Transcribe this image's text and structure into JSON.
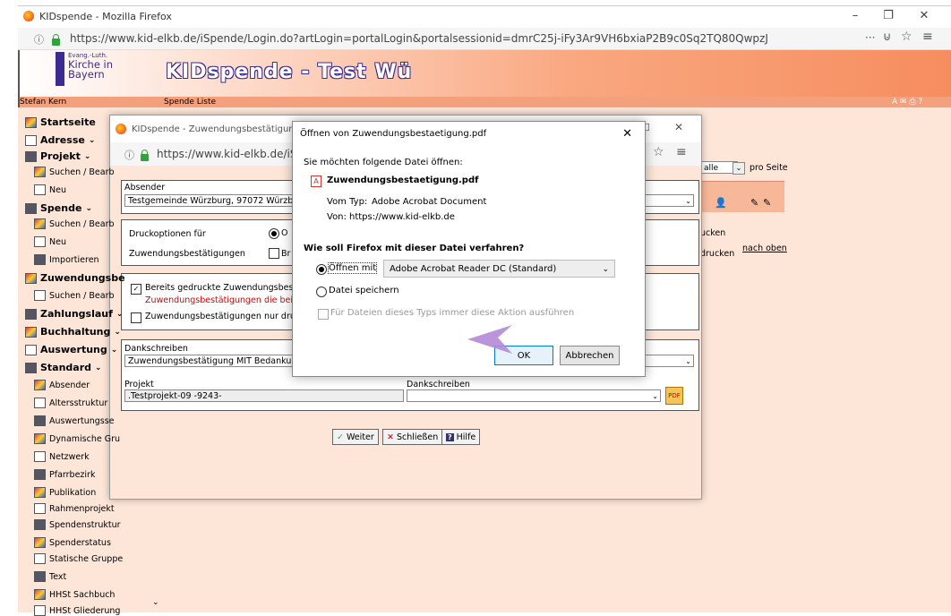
{
  "browser_outer": {
    "window_title": "KIDspende - Mozilla Firefox",
    "url": "https://www.kid-elkb.de/iSpende/Login.do?artLogin=portalLogin&portalsessionid=dmrC25j-iFy3Ar9VH6bxiaP2B9c0Sq2TQ80QwpzJ"
  },
  "app": {
    "logo_line1": "Evang.-Luth.",
    "logo_line2": "Kirche in",
    "logo_line3": "Bayern",
    "title": "KIDspende - Test Wü",
    "user": "Stefan Kern",
    "page_label": "Spende Liste"
  },
  "sidebar": {
    "items": [
      {
        "label": "Startseite",
        "bold": true
      },
      {
        "label": "Adresse",
        "bold": true
      },
      {
        "label": "Projekt",
        "bold": true
      },
      {
        "label": "Suchen / Bearb",
        "bold": false
      },
      {
        "label": "Neu",
        "bold": false
      },
      {
        "label": "Spende",
        "bold": true
      },
      {
        "label": "Suchen / Bearb",
        "bold": false
      },
      {
        "label": "Neu",
        "bold": false
      },
      {
        "label": "Importieren",
        "bold": false
      },
      {
        "label": "Zuwendungsbe",
        "bold": true
      },
      {
        "label": "Suchen / Bearb",
        "bold": false
      },
      {
        "label": "Zahlungslauf",
        "bold": true
      },
      {
        "label": "Buchhaltung",
        "bold": true
      },
      {
        "label": "Auswertung",
        "bold": true
      },
      {
        "label": "Standard",
        "bold": true
      },
      {
        "label": "Absender",
        "bold": false
      },
      {
        "label": "Altersstruktur",
        "bold": false
      },
      {
        "label": "Auswertungsse",
        "bold": false
      },
      {
        "label": "Dynamische Gru",
        "bold": false
      },
      {
        "label": "Netzwerk",
        "bold": false
      },
      {
        "label": "Pfarrbezirk",
        "bold": false
      },
      {
        "label": "Publikation",
        "bold": false
      },
      {
        "label": "Rahmenprojekt",
        "bold": false
      },
      {
        "label": "Spendenstruktur",
        "bold": false
      },
      {
        "label": "Spenderstatus",
        "bold": false
      },
      {
        "label": "Statische Gruppe",
        "bold": false
      },
      {
        "label": "Text",
        "bold": false
      },
      {
        "label": "HHSt Sachbuch",
        "bold": false
      },
      {
        "label": "HHSt Gliederung",
        "bold": false
      }
    ]
  },
  "right_area": {
    "page_select": "alle",
    "pro_seite": "pro Seite",
    "drucken1": "ucken",
    "drucken2": "drucken",
    "nach_oben": "nach oben"
  },
  "browser_inner": {
    "window_title": "KIDspende - Zuwendungsbestätigung",
    "url": "https://www.kid-elkb.de/iSpe"
  },
  "form": {
    "absender_label": "Absender",
    "absender_value": "Testgemeinde Würzburg, 97072 Würzburg,",
    "druckoptionen_label": "Druckoptionen für",
    "druck_opt_short": "O",
    "zuwendungsbest_label": "Zuwendungsbestätigungen",
    "zuw_short": "Br",
    "chk1_label": "Bereits gedruckte Zuwendungsbestätig",
    "chk1_note": "Zuwendungsbestätigungen die beim er",
    "chk2_label": "Zuwendungsbestätigungen nur drucke",
    "dankschreiben_label": "Dankschreiben",
    "dankschreiben_value": "Zuwendungsbestätigung MIT Bedankung a",
    "projekt_label": "Projekt",
    "projekt_value": ".Testprojekt-09 -9243-",
    "dankschreiben2_label": "Dankschreiben",
    "weiter": "Weiter",
    "schliessen": "Schließen",
    "hilfe": "Hilfe"
  },
  "dialog": {
    "title": "Öffnen von Zuwendungsbestaetigung.pdf",
    "intro": "Sie möchten folgende Datei öffnen:",
    "filename": "Zuwendungsbestaetigung.pdf",
    "type_label": "Vom Typ:",
    "type_value": "Adobe Acrobat Document",
    "from_label": "Von:",
    "from_value": "https://www.kid-elkb.de",
    "question": "Wie soll Firefox mit dieser Datei verfahren?",
    "open_with": "Öffnen mit",
    "open_app": "Adobe Acrobat Reader DC  (Standard)",
    "save_file": "Datei speichern",
    "always": "Für Dateien dieses Typs immer diese Aktion ausführen",
    "ok": "OK",
    "cancel": "Abbrechen",
    "open_with_selected": true
  }
}
